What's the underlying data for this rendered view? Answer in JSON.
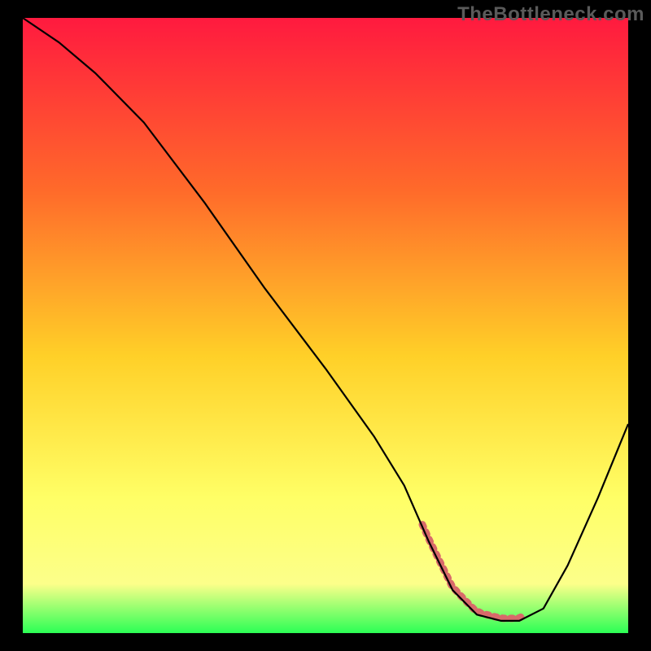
{
  "watermark": "TheBottleneck.com",
  "colors": {
    "gradient_top": "#ff1a3f",
    "gradient_mid1": "#ff6a2a",
    "gradient_mid2": "#ffd028",
    "gradient_mid3": "#ffff66",
    "gradient_bottom_yellow": "#fcff8a",
    "gradient_bottom_green": "#2bff55",
    "curve_color": "#000000",
    "good_band_color": "#d86a6a",
    "background": "#000000"
  },
  "chart_data": {
    "type": "line",
    "title": "",
    "xlabel": "",
    "ylabel": "",
    "xlim": [
      0,
      100
    ],
    "ylim": [
      0,
      100
    ],
    "grid": false,
    "legend": false,
    "series": [
      {
        "name": "bottleneck-curve",
        "x": [
          0,
          6,
          12,
          20,
          30,
          40,
          50,
          58,
          63,
          67,
          71,
          75,
          79,
          82,
          86,
          90,
          95,
          100
        ],
        "y": [
          100,
          96,
          91,
          83,
          70,
          56,
          43,
          32,
          24,
          15,
          7,
          3,
          2,
          2,
          4,
          11,
          22,
          34
        ]
      }
    ],
    "good_range_x": [
      66,
      83
    ],
    "annotations": []
  }
}
